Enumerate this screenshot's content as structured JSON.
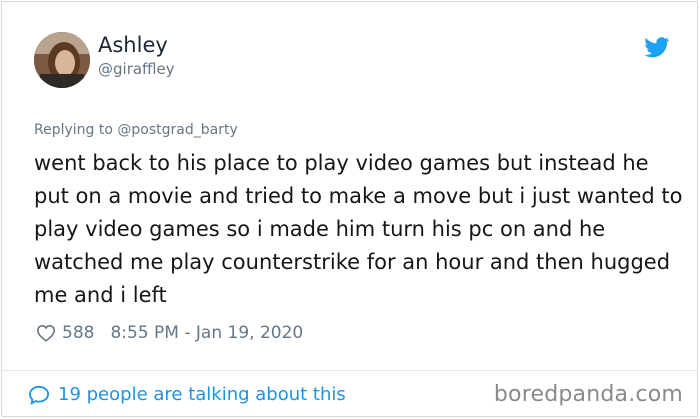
{
  "author": {
    "name": "Ashley",
    "handle": "@giraffley"
  },
  "reply": {
    "prefix": "Replying to",
    "target": "@postgrad_barty"
  },
  "tweet": {
    "text": "went back to his place to play video games but instead he put on a movie and tried to make a move but i just wanted to play video games so i made him turn his pc on and he watched me play counterstrike for an hour and then hugged me and i left"
  },
  "meta": {
    "likes": "588",
    "timestamp": "8:55 PM - Jan 19, 2020"
  },
  "footer": {
    "talking": "19 people are talking about this",
    "watermark": "boredpanda.com"
  },
  "colors": {
    "twitter_blue": "#1da1f2",
    "link_blue": "#1b95e0",
    "muted": "#657786"
  },
  "icons": {
    "bird": "twitter-bird-icon",
    "heart": "heart-icon",
    "bubble": "speech-bubble-icon"
  }
}
